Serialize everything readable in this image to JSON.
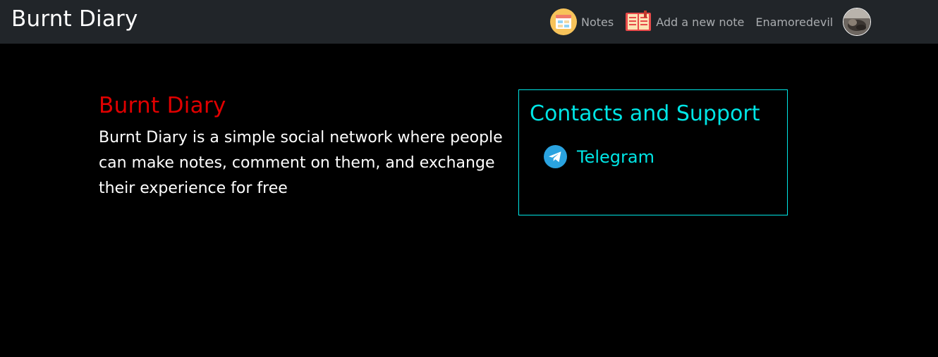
{
  "navbar": {
    "brand": "Burnt Diary",
    "notes_label": "Notes",
    "notes_icon": "notes-icon",
    "add_note_label": "Add a new note",
    "add_note_icon": "add-note-icon",
    "username": "Enamoredevil",
    "avatar_icon": "avatar"
  },
  "about": {
    "title": "Burnt Diary",
    "text": "Burnt Diary is a simple social network where people can make notes, comment on them, and exchange their experience for free"
  },
  "contacts": {
    "title": "Contacts and Support",
    "links": [
      {
        "label": "Telegram",
        "icon": "telegram-icon"
      }
    ]
  },
  "colors": {
    "navbar_bg": "#212529",
    "page_bg": "#000000",
    "accent_red": "#e00000",
    "accent_cyan": "#00e5e5",
    "nav_text": "#a9acaf",
    "telegram_blue": "#2aa3e0"
  }
}
